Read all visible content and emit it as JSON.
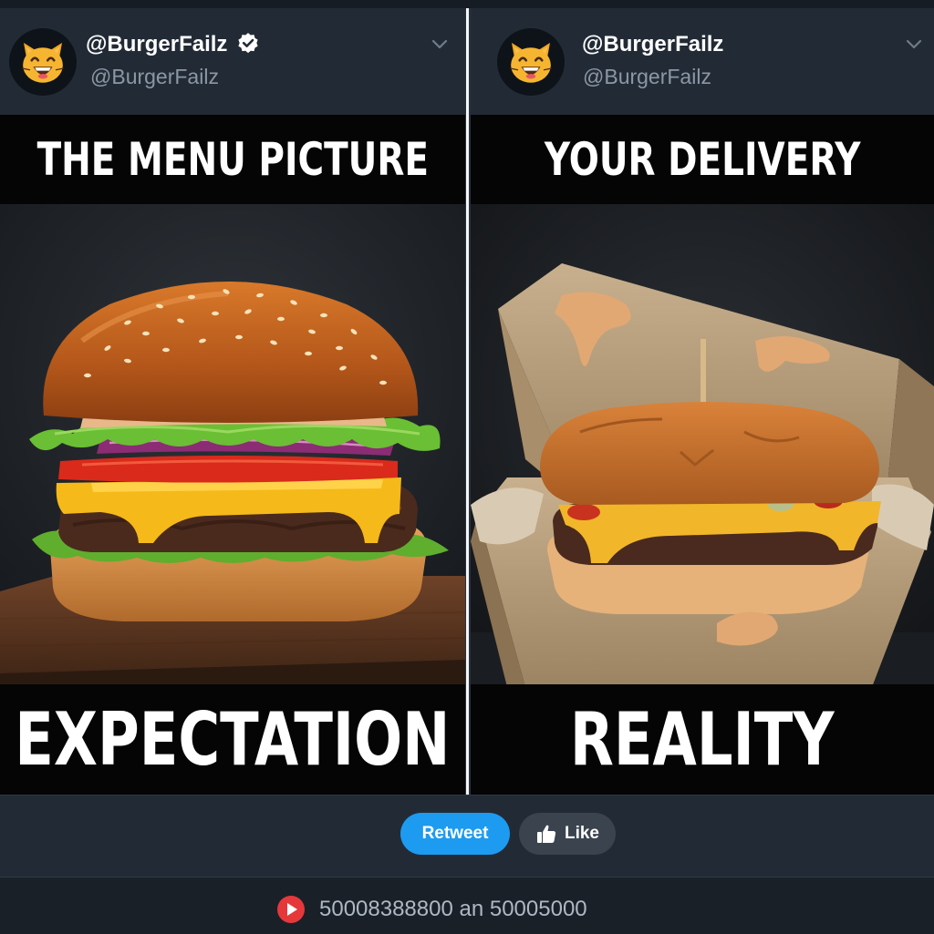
{
  "left_post": {
    "display_name": "@BurgerFailz",
    "handle": "@BurgerFailz",
    "verified": true,
    "avatar_icon": "grinning-cat-emoji",
    "caption_top": "THE MENU PICTURE",
    "caption_bottom": "EXPECTATION",
    "image": "perfect-cheeseburger-photo"
  },
  "right_post": {
    "display_name": "@BurgerFailz",
    "handle": "@BurgerFailz",
    "verified": false,
    "avatar_icon": "grinning-cat-emoji",
    "caption_top": "YOUR DELIVERY",
    "caption_bottom": "REALITY",
    "image": "squashed-cheeseburger-in-box-photo"
  },
  "actions": {
    "retweet_label": "Retweet",
    "like_label": "Like",
    "like_icon": "thumbs-up-icon"
  },
  "footer": {
    "icon": "play-icon",
    "text": "50008388800 an 50005000"
  },
  "colors": {
    "accent_blue": "#1d9bf0",
    "panel_bg": "#1f2731",
    "caption_bg": "#050505",
    "play_red": "#e5383b"
  }
}
